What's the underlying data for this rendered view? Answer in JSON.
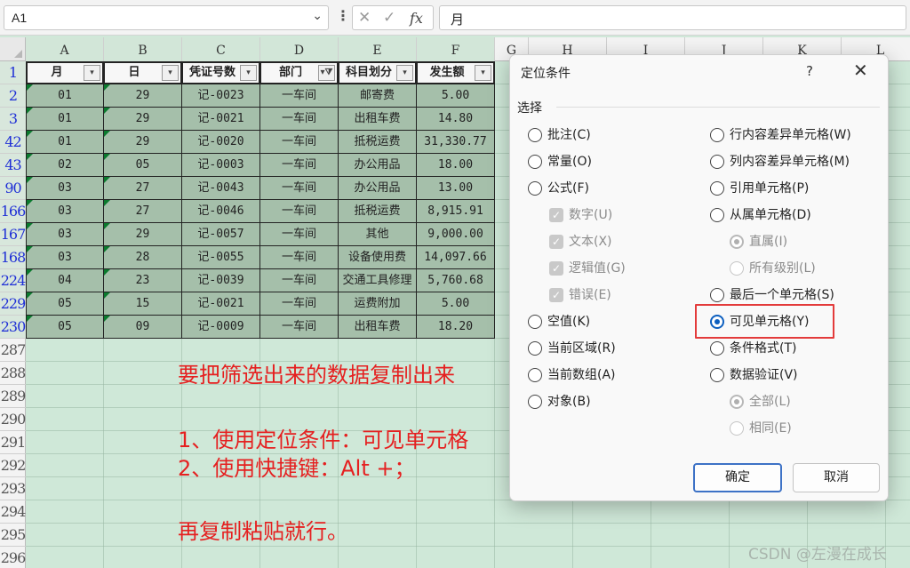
{
  "formula_bar": {
    "name_box": "A1",
    "fx_label": "fx",
    "formula": "月"
  },
  "columns": [
    "A",
    "B",
    "C",
    "D",
    "E",
    "F",
    "G",
    "H",
    "I",
    "J",
    "K",
    "L"
  ],
  "rows": [
    "1",
    "2",
    "3",
    "42",
    "43",
    "90",
    "166",
    "167",
    "168",
    "224",
    "229",
    "230",
    "287",
    "288",
    "289",
    "290",
    "291",
    "292",
    "293",
    "294",
    "295",
    "296"
  ],
  "table": {
    "headers": [
      "月",
      "日",
      "凭证号数",
      "部门",
      "科目划分",
      "发生额"
    ],
    "data": [
      [
        "01",
        "29",
        "记-0023",
        "一车间",
        "邮寄费",
        "5.00"
      ],
      [
        "01",
        "29",
        "记-0021",
        "一车间",
        "出租车费",
        "14.80"
      ],
      [
        "01",
        "29",
        "记-0020",
        "一车间",
        "抵税运费",
        "31,330.77"
      ],
      [
        "02",
        "05",
        "记-0003",
        "一车间",
        "办公用品",
        "18.00"
      ],
      [
        "03",
        "27",
        "记-0043",
        "一车间",
        "办公用品",
        "13.00"
      ],
      [
        "03",
        "27",
        "记-0046",
        "一车间",
        "抵税运费",
        "8,915.91"
      ],
      [
        "03",
        "29",
        "记-0057",
        "一车间",
        "其他",
        "9,000.00"
      ],
      [
        "03",
        "28",
        "记-0055",
        "一车间",
        "设备使用费",
        "14,097.66"
      ],
      [
        "04",
        "23",
        "记-0039",
        "一车间",
        "交通工具修理",
        "5,760.68"
      ],
      [
        "05",
        "15",
        "记-0021",
        "一车间",
        "运费附加",
        "5.00"
      ],
      [
        "05",
        "09",
        "记-0009",
        "一车间",
        "出租车费",
        "18.20"
      ]
    ]
  },
  "notes": [
    "要把筛选出来的数据复制出来",
    "1、使用定位条件：可见单元格",
    "2、使用快捷键：Alt +；",
    "再复制粘贴就行。"
  ],
  "dialog": {
    "title": "定位条件",
    "help": "?",
    "close": "✕",
    "group_label": "选择",
    "left_options": [
      {
        "label": "批注(C)",
        "kind": "radio",
        "checked": false,
        "disabled": false
      },
      {
        "label": "常量(O)",
        "kind": "radio",
        "checked": false,
        "disabled": false
      },
      {
        "label": "公式(F)",
        "kind": "radio",
        "checked": false,
        "disabled": false
      },
      {
        "label": "数字(U)",
        "kind": "check",
        "checked": true,
        "disabled": true
      },
      {
        "label": "文本(X)",
        "kind": "check",
        "checked": true,
        "disabled": true
      },
      {
        "label": "逻辑值(G)",
        "kind": "check",
        "checked": true,
        "disabled": true
      },
      {
        "label": "错误(E)",
        "kind": "check",
        "checked": true,
        "disabled": true
      },
      {
        "label": "空值(K)",
        "kind": "radio",
        "checked": false,
        "disabled": false
      },
      {
        "label": "当前区域(R)",
        "kind": "radio",
        "checked": false,
        "disabled": false
      },
      {
        "label": "当前数组(A)",
        "kind": "radio",
        "checked": false,
        "disabled": false
      },
      {
        "label": "对象(B)",
        "kind": "radio",
        "checked": false,
        "disabled": false
      }
    ],
    "right_options": [
      {
        "label": "行内容差异单元格(W)",
        "kind": "radio",
        "checked": false,
        "disabled": false
      },
      {
        "label": "列内容差异单元格(M)",
        "kind": "radio",
        "checked": false,
        "disabled": false
      },
      {
        "label": "引用单元格(P)",
        "kind": "radio",
        "checked": false,
        "disabled": false
      },
      {
        "label": "从属单元格(D)",
        "kind": "radio",
        "checked": false,
        "disabled": false
      },
      {
        "label": "直属(I)",
        "kind": "radio",
        "checked": true,
        "disabled": true
      },
      {
        "label": "所有级别(L)",
        "kind": "radio",
        "checked": false,
        "disabled": true
      },
      {
        "label": "最后一个单元格(S)",
        "kind": "radio",
        "checked": false,
        "disabled": false
      },
      {
        "label": "可见单元格(Y)",
        "kind": "radio",
        "checked": true,
        "disabled": false
      },
      {
        "label": "条件格式(T)",
        "kind": "radio",
        "checked": false,
        "disabled": false
      },
      {
        "label": "数据验证(V)",
        "kind": "radio",
        "checked": false,
        "disabled": false
      },
      {
        "label": "全部(L)",
        "kind": "radio",
        "checked": true,
        "disabled": true
      },
      {
        "label": "相同(E)",
        "kind": "radio",
        "checked": false,
        "disabled": true
      }
    ],
    "ok": "确定",
    "cancel": "取消"
  },
  "watermark": "CSDN @左漫在成长"
}
